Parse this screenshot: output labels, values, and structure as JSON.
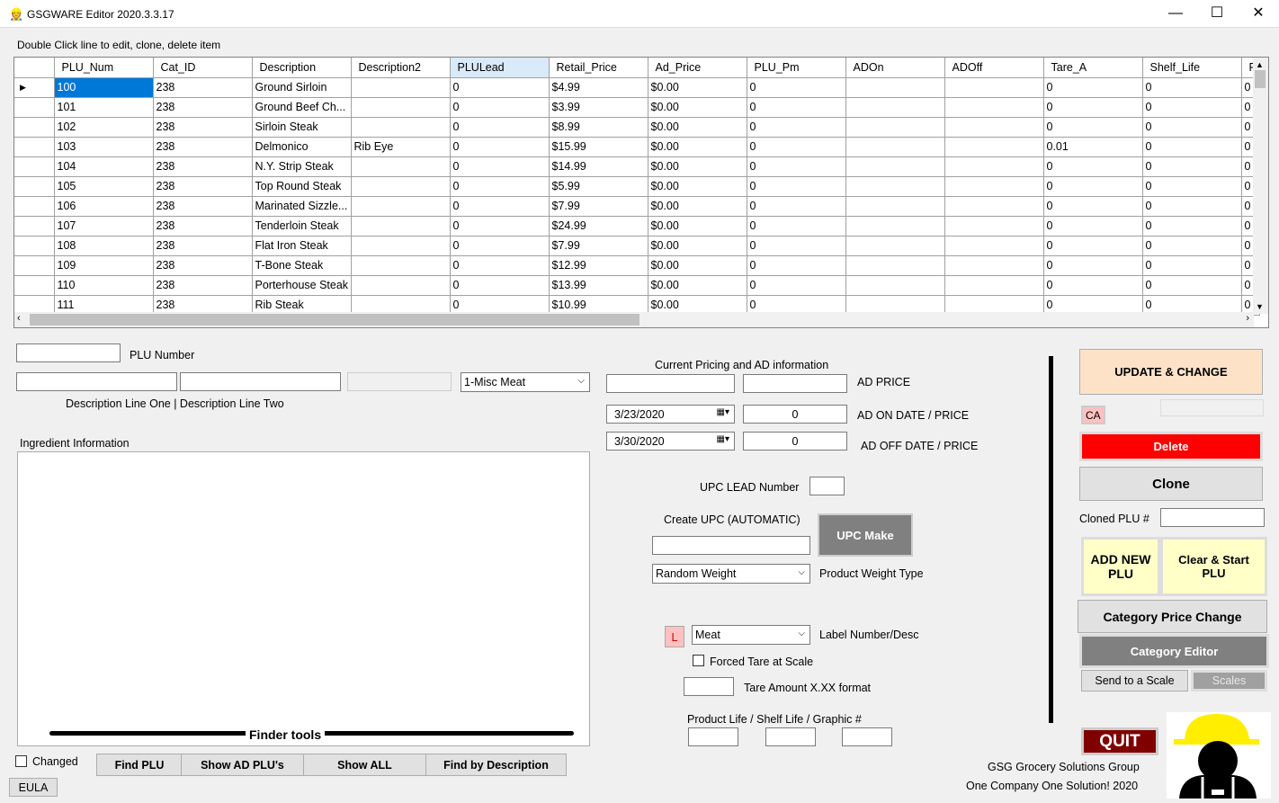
{
  "window": {
    "title": "GSGWARE Editor 2020.3.3.17",
    "minimize": "—",
    "maximize": "☐",
    "close": "✕"
  },
  "hint": "Double Click line to edit, clone, delete item",
  "grid": {
    "columns": [
      "PLU_Num",
      "Cat_ID",
      "Description",
      "Description2",
      "PLULead",
      "Retail_Price",
      "Ad_Price",
      "PLU_Pm",
      "ADOn",
      "ADOff",
      "Tare_A",
      "Shelf_Life",
      "F"
    ],
    "rows": [
      [
        "100",
        "238",
        "Ground Sirloin",
        "",
        "0",
        "$4.99",
        "$0.00",
        "0",
        "",
        "",
        "0",
        "0",
        "0"
      ],
      [
        "101",
        "238",
        "Ground Beef Ch...",
        "",
        "0",
        "$3.99",
        "$0.00",
        "0",
        "",
        "",
        "0",
        "0",
        "0"
      ],
      [
        "102",
        "238",
        "Sirloin Steak",
        "",
        "0",
        "$8.99",
        "$0.00",
        "0",
        "",
        "",
        "0",
        "0",
        "0"
      ],
      [
        "103",
        "238",
        "Delmonico",
        "Rib Eye",
        "0",
        "$15.99",
        "$0.00",
        "0",
        "",
        "",
        "0.01",
        "0",
        "0"
      ],
      [
        "104",
        "238",
        "N.Y. Strip Steak",
        "",
        "0",
        "$14.99",
        "$0.00",
        "0",
        "",
        "",
        "0",
        "0",
        "0"
      ],
      [
        "105",
        "238",
        "Top Round Steak",
        "",
        "0",
        "$5.99",
        "$0.00",
        "0",
        "",
        "",
        "0",
        "0",
        "0"
      ],
      [
        "106",
        "238",
        "Marinated Sizzle...",
        "",
        "0",
        "$7.99",
        "$0.00",
        "0",
        "",
        "",
        "0",
        "0",
        "0"
      ],
      [
        "107",
        "238",
        "Tenderloin Steak",
        "",
        "0",
        "$24.99",
        "$0.00",
        "0",
        "",
        "",
        "0",
        "0",
        "0"
      ],
      [
        "108",
        "238",
        "Flat Iron Steak",
        "",
        "0",
        "$7.99",
        "$0.00",
        "0",
        "",
        "",
        "0",
        "0",
        "0"
      ],
      [
        "109",
        "238",
        "T-Bone Steak",
        "",
        "0",
        "$12.99",
        "$0.00",
        "0",
        "",
        "",
        "0",
        "0",
        "0"
      ],
      [
        "110",
        "238",
        "Porterhouse Steak",
        "",
        "0",
        "$13.99",
        "$0.00",
        "0",
        "",
        "",
        "0",
        "0",
        "0"
      ],
      [
        "111",
        "238",
        "Rib Steak",
        "",
        "0",
        "$10.99",
        "$0.00",
        "0",
        "",
        "",
        "0",
        "0",
        "0"
      ]
    ]
  },
  "form": {
    "plu_number_label": "PLU Number",
    "desc_label": "Description Line One   |  Description Line Two",
    "category_select": "1-Misc Meat",
    "ingredient_label": "Ingredient Information",
    "finder_tools": "Finder tools",
    "changed_label": "Changed",
    "find_plu": "Find PLU",
    "show_ad": "Show AD PLU's",
    "show_all": "Show ALL",
    "find_desc": "Find by Description",
    "eula": "EULA",
    "pricing_header": "Current Pricing and AD information",
    "ad_price_label": "AD PRICE",
    "ad_on_date": "3/23/2020",
    "ad_on_price": "0",
    "ad_on_label": "AD ON DATE / PRICE",
    "ad_off_date": "3/30/2020",
    "ad_off_price": "0",
    "ad_off_label": "AD OFF DATE / PRICE",
    "upc_lead_label": "UPC LEAD Number",
    "create_upc_label": "Create UPC (AUTOMATIC)",
    "upc_make": "UPC Make",
    "weight_type": "Random Weight",
    "weight_type_label": "Product Weight Type",
    "label_badge": "L",
    "label_select": "Meat",
    "label_desc": "Label Number/Desc",
    "forced_tare": "Forced Tare at Scale",
    "tare_amount": "Tare Amount X.XX format",
    "life_label": "Product Life   /   Shelf Life   /   Graphic #"
  },
  "actions": {
    "update": "UPDATE & CHANGE",
    "ca": "CA",
    "delete": "Delete",
    "clone": "Clone",
    "cloned_plu": "Cloned PLU #",
    "add_new": "ADD NEW PLU",
    "clear_start": "Clear & Start PLU",
    "category_price": "Category Price Change",
    "category_editor": "Category Editor",
    "send_scale": "Send to a Scale",
    "scales": "Scales",
    "quit": "QUIT",
    "company": "GSG Grocery Solutions Group",
    "slogan": "One Company One Solution! 2020"
  },
  "colors": {
    "selection": "#0078d7",
    "update": "#fde2c8",
    "delete": "#ff0000",
    "add": "#ffffc8",
    "editor": "#808080",
    "quit": "#800000",
    "hardhat": "#ffee00"
  }
}
